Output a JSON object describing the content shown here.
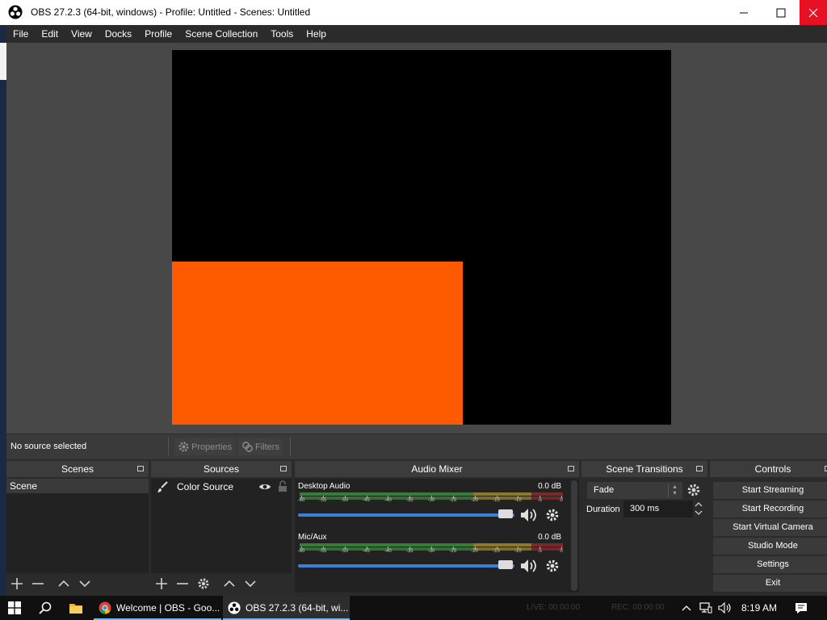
{
  "window": {
    "title": "OBS 27.2.3 (64-bit, windows) - Profile: Untitled - Scenes: Untitled",
    "controls": {
      "minimize": "—",
      "maximize": "☐",
      "close": "✕"
    }
  },
  "menubar": [
    "File",
    "Edit",
    "View",
    "Docks",
    "Profile",
    "Scene Collection",
    "Tools",
    "Help"
  ],
  "preview": {
    "background": "#000000",
    "source_color": "#ff5a00"
  },
  "source_toolbar": {
    "status": "No source selected",
    "properties_label": "Properties",
    "filters_label": "Filters"
  },
  "docks": {
    "scenes": {
      "title": "Scenes",
      "items": [
        "Scene"
      ]
    },
    "sources": {
      "title": "Sources",
      "items": [
        {
          "label": "Color Source",
          "visible": true,
          "locked": false
        }
      ]
    },
    "audio_mixer": {
      "title": "Audio Mixer",
      "ticks": [
        "-60",
        "-55",
        "-50",
        "-45",
        "-40",
        "-35",
        "-30",
        "-25",
        "-20",
        "-15",
        "-10",
        "-5",
        "0"
      ],
      "channels": [
        {
          "name": "Desktop Audio",
          "db": "0.0 dB",
          "volume": 1.0
        },
        {
          "name": "Mic/Aux",
          "db": "0.0 dB",
          "volume": 1.0
        }
      ]
    },
    "scene_transitions": {
      "title": "Scene Transitions",
      "transition": "Fade",
      "duration_label": "Duration",
      "duration_value": "300 ms"
    },
    "controls": {
      "title": "Controls",
      "buttons": [
        "Start Streaming",
        "Start Recording",
        "Start Virtual Camera",
        "Studio Mode",
        "Settings",
        "Exit"
      ]
    }
  },
  "status_faint": {
    "live": "LIVE: 00:00:00",
    "rec": "REC: 00:00:00"
  },
  "taskbar": {
    "apps": [
      {
        "label": "Welcome | OBS - Goo...",
        "icon": "chrome-icon"
      },
      {
        "label": "OBS 27.2.3 (64-bit, wi...",
        "icon": "obs-icon"
      }
    ],
    "clock": "8:19 AM"
  }
}
